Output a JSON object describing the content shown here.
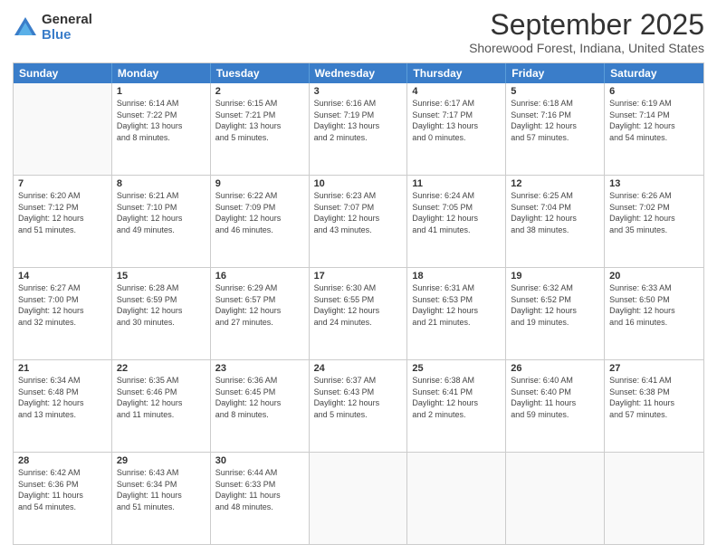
{
  "logo": {
    "general": "General",
    "blue": "Blue"
  },
  "title": "September 2025",
  "location": "Shorewood Forest, Indiana, United States",
  "header_days": [
    "Sunday",
    "Monday",
    "Tuesday",
    "Wednesday",
    "Thursday",
    "Friday",
    "Saturday"
  ],
  "weeks": [
    [
      {
        "day": "",
        "info": ""
      },
      {
        "day": "1",
        "info": "Sunrise: 6:14 AM\nSunset: 7:22 PM\nDaylight: 13 hours\nand 8 minutes."
      },
      {
        "day": "2",
        "info": "Sunrise: 6:15 AM\nSunset: 7:21 PM\nDaylight: 13 hours\nand 5 minutes."
      },
      {
        "day": "3",
        "info": "Sunrise: 6:16 AM\nSunset: 7:19 PM\nDaylight: 13 hours\nand 2 minutes."
      },
      {
        "day": "4",
        "info": "Sunrise: 6:17 AM\nSunset: 7:17 PM\nDaylight: 13 hours\nand 0 minutes."
      },
      {
        "day": "5",
        "info": "Sunrise: 6:18 AM\nSunset: 7:16 PM\nDaylight: 12 hours\nand 57 minutes."
      },
      {
        "day": "6",
        "info": "Sunrise: 6:19 AM\nSunset: 7:14 PM\nDaylight: 12 hours\nand 54 minutes."
      }
    ],
    [
      {
        "day": "7",
        "info": "Sunrise: 6:20 AM\nSunset: 7:12 PM\nDaylight: 12 hours\nand 51 minutes."
      },
      {
        "day": "8",
        "info": "Sunrise: 6:21 AM\nSunset: 7:10 PM\nDaylight: 12 hours\nand 49 minutes."
      },
      {
        "day": "9",
        "info": "Sunrise: 6:22 AM\nSunset: 7:09 PM\nDaylight: 12 hours\nand 46 minutes."
      },
      {
        "day": "10",
        "info": "Sunrise: 6:23 AM\nSunset: 7:07 PM\nDaylight: 12 hours\nand 43 minutes."
      },
      {
        "day": "11",
        "info": "Sunrise: 6:24 AM\nSunset: 7:05 PM\nDaylight: 12 hours\nand 41 minutes."
      },
      {
        "day": "12",
        "info": "Sunrise: 6:25 AM\nSunset: 7:04 PM\nDaylight: 12 hours\nand 38 minutes."
      },
      {
        "day": "13",
        "info": "Sunrise: 6:26 AM\nSunset: 7:02 PM\nDaylight: 12 hours\nand 35 minutes."
      }
    ],
    [
      {
        "day": "14",
        "info": "Sunrise: 6:27 AM\nSunset: 7:00 PM\nDaylight: 12 hours\nand 32 minutes."
      },
      {
        "day": "15",
        "info": "Sunrise: 6:28 AM\nSunset: 6:59 PM\nDaylight: 12 hours\nand 30 minutes."
      },
      {
        "day": "16",
        "info": "Sunrise: 6:29 AM\nSunset: 6:57 PM\nDaylight: 12 hours\nand 27 minutes."
      },
      {
        "day": "17",
        "info": "Sunrise: 6:30 AM\nSunset: 6:55 PM\nDaylight: 12 hours\nand 24 minutes."
      },
      {
        "day": "18",
        "info": "Sunrise: 6:31 AM\nSunset: 6:53 PM\nDaylight: 12 hours\nand 21 minutes."
      },
      {
        "day": "19",
        "info": "Sunrise: 6:32 AM\nSunset: 6:52 PM\nDaylight: 12 hours\nand 19 minutes."
      },
      {
        "day": "20",
        "info": "Sunrise: 6:33 AM\nSunset: 6:50 PM\nDaylight: 12 hours\nand 16 minutes."
      }
    ],
    [
      {
        "day": "21",
        "info": "Sunrise: 6:34 AM\nSunset: 6:48 PM\nDaylight: 12 hours\nand 13 minutes."
      },
      {
        "day": "22",
        "info": "Sunrise: 6:35 AM\nSunset: 6:46 PM\nDaylight: 12 hours\nand 11 minutes."
      },
      {
        "day": "23",
        "info": "Sunrise: 6:36 AM\nSunset: 6:45 PM\nDaylight: 12 hours\nand 8 minutes."
      },
      {
        "day": "24",
        "info": "Sunrise: 6:37 AM\nSunset: 6:43 PM\nDaylight: 12 hours\nand 5 minutes."
      },
      {
        "day": "25",
        "info": "Sunrise: 6:38 AM\nSunset: 6:41 PM\nDaylight: 12 hours\nand 2 minutes."
      },
      {
        "day": "26",
        "info": "Sunrise: 6:40 AM\nSunset: 6:40 PM\nDaylight: 11 hours\nand 59 minutes."
      },
      {
        "day": "27",
        "info": "Sunrise: 6:41 AM\nSunset: 6:38 PM\nDaylight: 11 hours\nand 57 minutes."
      }
    ],
    [
      {
        "day": "28",
        "info": "Sunrise: 6:42 AM\nSunset: 6:36 PM\nDaylight: 11 hours\nand 54 minutes."
      },
      {
        "day": "29",
        "info": "Sunrise: 6:43 AM\nSunset: 6:34 PM\nDaylight: 11 hours\nand 51 minutes."
      },
      {
        "day": "30",
        "info": "Sunrise: 6:44 AM\nSunset: 6:33 PM\nDaylight: 11 hours\nand 48 minutes."
      },
      {
        "day": "",
        "info": ""
      },
      {
        "day": "",
        "info": ""
      },
      {
        "day": "",
        "info": ""
      },
      {
        "day": "",
        "info": ""
      }
    ]
  ]
}
